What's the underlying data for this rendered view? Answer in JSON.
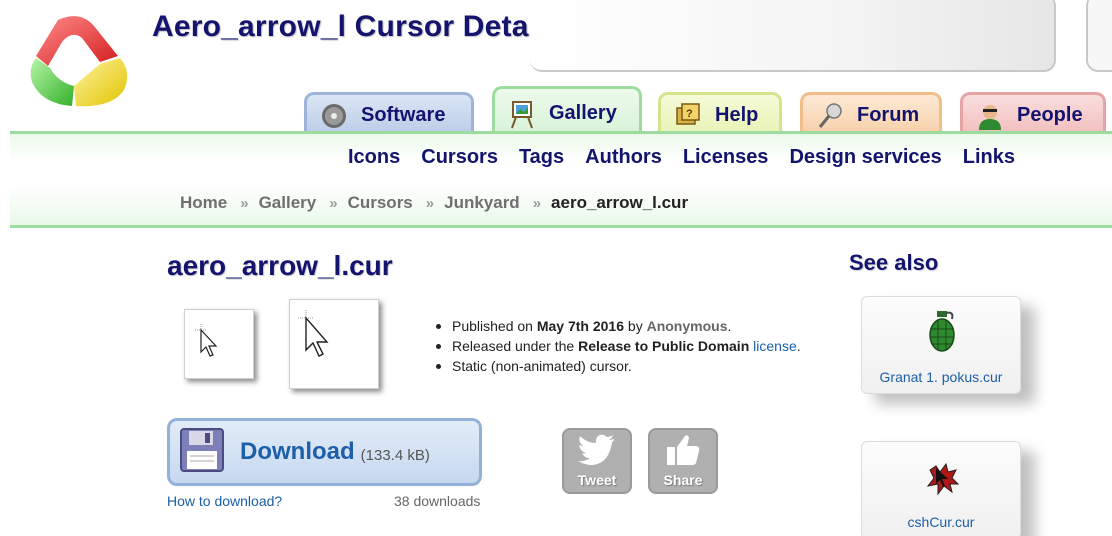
{
  "header": {
    "title": "Aero_arrow_l Cursor Details"
  },
  "tabs": [
    {
      "label": "Software",
      "icon": "disc-icon"
    },
    {
      "label": "Gallery",
      "icon": "easel-icon",
      "active": true
    },
    {
      "label": "Help",
      "icon": "help-icon"
    },
    {
      "label": "Forum",
      "icon": "microphone-icon"
    },
    {
      "label": "People",
      "icon": "person-icon"
    }
  ],
  "nav": {
    "links": [
      "Icons",
      "Cursors",
      "Tags",
      "Authors",
      "Licenses",
      "Design services",
      "Links"
    ]
  },
  "breadcrumb": {
    "items": [
      "Home",
      "Gallery",
      "Cursors",
      "Junkyard",
      "aero_arrow_l.cur"
    ],
    "separator": "»"
  },
  "main": {
    "title": "aero_arrow_l.cur",
    "details": {
      "published_prefix": "Published on ",
      "published_date": "May 7th 2016",
      "published_by": " by ",
      "author": "Anonymous",
      "published_end": ".",
      "released_prefix": "Released under the ",
      "license_name": "Release to Public Domain",
      "license_link": "license",
      "released_end": ".",
      "static_text": "Static (non-animated) cursor."
    },
    "download": {
      "label": "Download",
      "size": "(133.4 kB)",
      "how_to": "How to download?",
      "count": "38 downloads"
    },
    "social": {
      "tweet": "Tweet",
      "share": "Share"
    }
  },
  "see_also": {
    "title": "See also",
    "items": [
      {
        "label": "Granat 1. pokus.cur"
      },
      {
        "label": "cshCur.cur"
      }
    ]
  },
  "colors": {
    "title_navy": "#14146e",
    "link_blue": "#1a5fa8",
    "green_border": "#9edb9e",
    "download_bg": "#c6d8ef"
  }
}
